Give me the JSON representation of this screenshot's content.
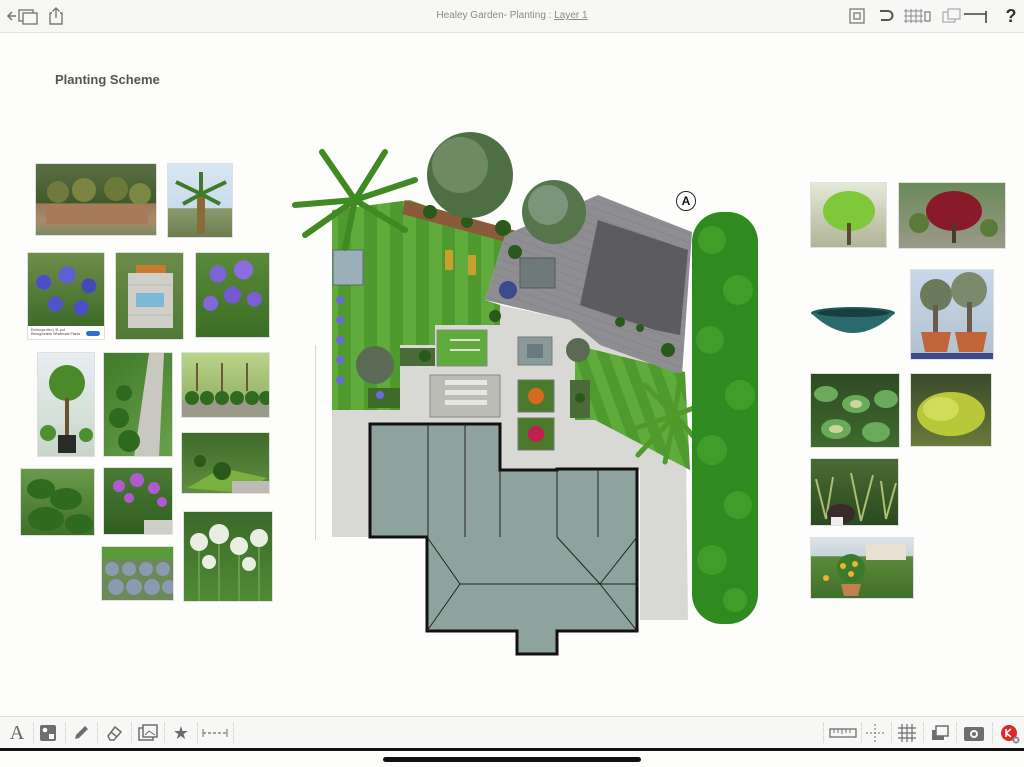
{
  "app": {
    "title": "Healey Garden- Planting",
    "title_sep": " : ",
    "layer": "Layer 1"
  },
  "topbar": {
    "icons_left": [
      "back-to-files-icon",
      "share-icon"
    ],
    "icons_right": [
      "frame-capture-icon",
      "undo-icon",
      "grid-lock-icon",
      "layers-line-icon",
      "help-icon"
    ]
  },
  "canvas": {
    "heading": "Planting Scheme",
    "north_marker": "A",
    "left_images": [
      "topiary-wall",
      "palm-tree",
      "allium-blue",
      "paved-courtyard",
      "agapanthus",
      "standard-tree",
      "box-balls-path",
      "box-hedge-row",
      "lawn-topiary",
      "box-hedge-cloud",
      "allium-border",
      "lavender-mounds",
      "allium-white"
    ],
    "right_images": [
      "acer-green",
      "acer-red",
      "teal-bowl-planter",
      "olive-trees-pots",
      "hosta-border",
      "hakonechloa-grass",
      "ornamental-grasses",
      "citrus-terrace"
    ],
    "small_caption": "Echinops ritro | 9L pot Recognizable Wholesale Plants"
  },
  "bottombar": {
    "tools_left": [
      "text-tool-icon",
      "shapes-tool-icon",
      "pen-tool-icon",
      "eraser-tool-icon",
      "images-tool-icon",
      "favourites-star-icon",
      "dimension-line-icon"
    ],
    "tools_right": [
      "ruler-icon",
      "guides-icon",
      "grid-icon",
      "layers-icon",
      "settings-camera-icon",
      "record-badge-icon"
    ],
    "text_glyph": "A"
  },
  "colors": {
    "lawn": "#4c8f2c",
    "lawn_stripe": "#5ba33a",
    "paving": "#d9d9d6",
    "deck": "#8c8c90",
    "roof": "#8ea39d",
    "hedge": "#2f8a1f",
    "accent_red": "#e0262b"
  }
}
